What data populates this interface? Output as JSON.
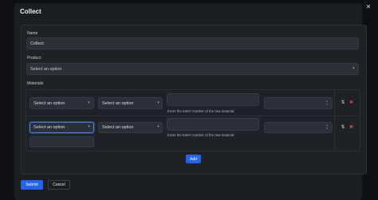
{
  "modal": {
    "title": "Collect",
    "close_glyph": "✕"
  },
  "form": {
    "name_label": "Name",
    "name_value": "Collect",
    "product_label": "Product",
    "product_placeholder": "Select an option",
    "materials_label": "Materials"
  },
  "materials": {
    "rows": [
      {
        "material": "Select an option",
        "unit": "Select an option",
        "batch_value": "",
        "batch_hint": "Enter the batch number of the raw material.",
        "quantity": ""
      },
      {
        "material": "Select an option",
        "unit": "Select an option",
        "batch_value": "",
        "batch_hint": "Enter the batch number of the raw material.",
        "quantity": ""
      }
    ]
  },
  "buttons": {
    "add": "Add",
    "submit": "Submit",
    "cancel": "Cancel"
  },
  "icons": {
    "close": "close-icon",
    "chevron": "chevron-down-icon",
    "swap": "swap-icon",
    "delete": "trash-icon"
  },
  "colors": {
    "accent": "#2563eb",
    "danger": "#e5484d",
    "background": "#1a1d21"
  }
}
